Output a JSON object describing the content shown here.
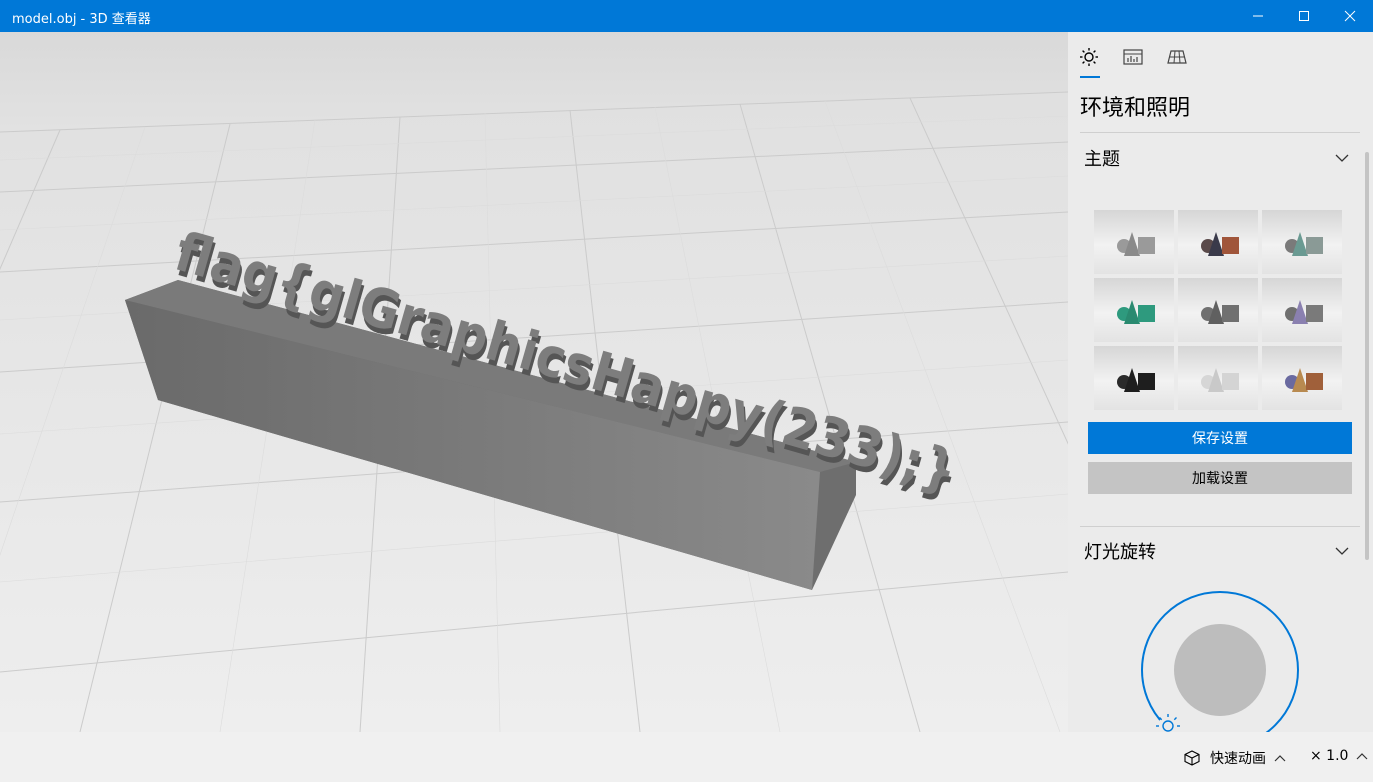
{
  "window": {
    "title": "model.obj - 3D 查看器",
    "buttons": {
      "minimize": "minimize-icon",
      "maximize": "maximize-icon",
      "close": "close-icon"
    }
  },
  "viewport": {
    "model_text": "flag{glGraphicsHappy(233);}"
  },
  "panel": {
    "tabs": [
      "sun-icon",
      "stats-icon",
      "grid-icon"
    ],
    "heading": "环境和照明",
    "theme_section": {
      "title": "主题"
    },
    "themes": [
      {
        "id": "gray",
        "color": "#9a9a9a"
      },
      {
        "id": "brown",
        "color": "#a0553a"
      },
      {
        "id": "teal-gray",
        "color": "#6a9a92"
      },
      {
        "id": "green",
        "color": "#2e9a7e"
      },
      {
        "id": "dark-gray",
        "color": "#707070"
      },
      {
        "id": "purple",
        "color": "#8a80b0"
      },
      {
        "id": "black",
        "color": "#1e1e1e"
      },
      {
        "id": "white",
        "color": "#cfcfcf"
      },
      {
        "id": "gold",
        "color": "#b88a50"
      }
    ],
    "save_label": "保存设置",
    "load_label": "加载设置",
    "light_section": {
      "title": "灯光旋转"
    }
  },
  "statusbar": {
    "animation_label": "快速动画",
    "speed_label": "× 1.0"
  },
  "colors": {
    "accent": "#0078d7",
    "panel_bg": "#ebebeb",
    "model": "#808080"
  }
}
